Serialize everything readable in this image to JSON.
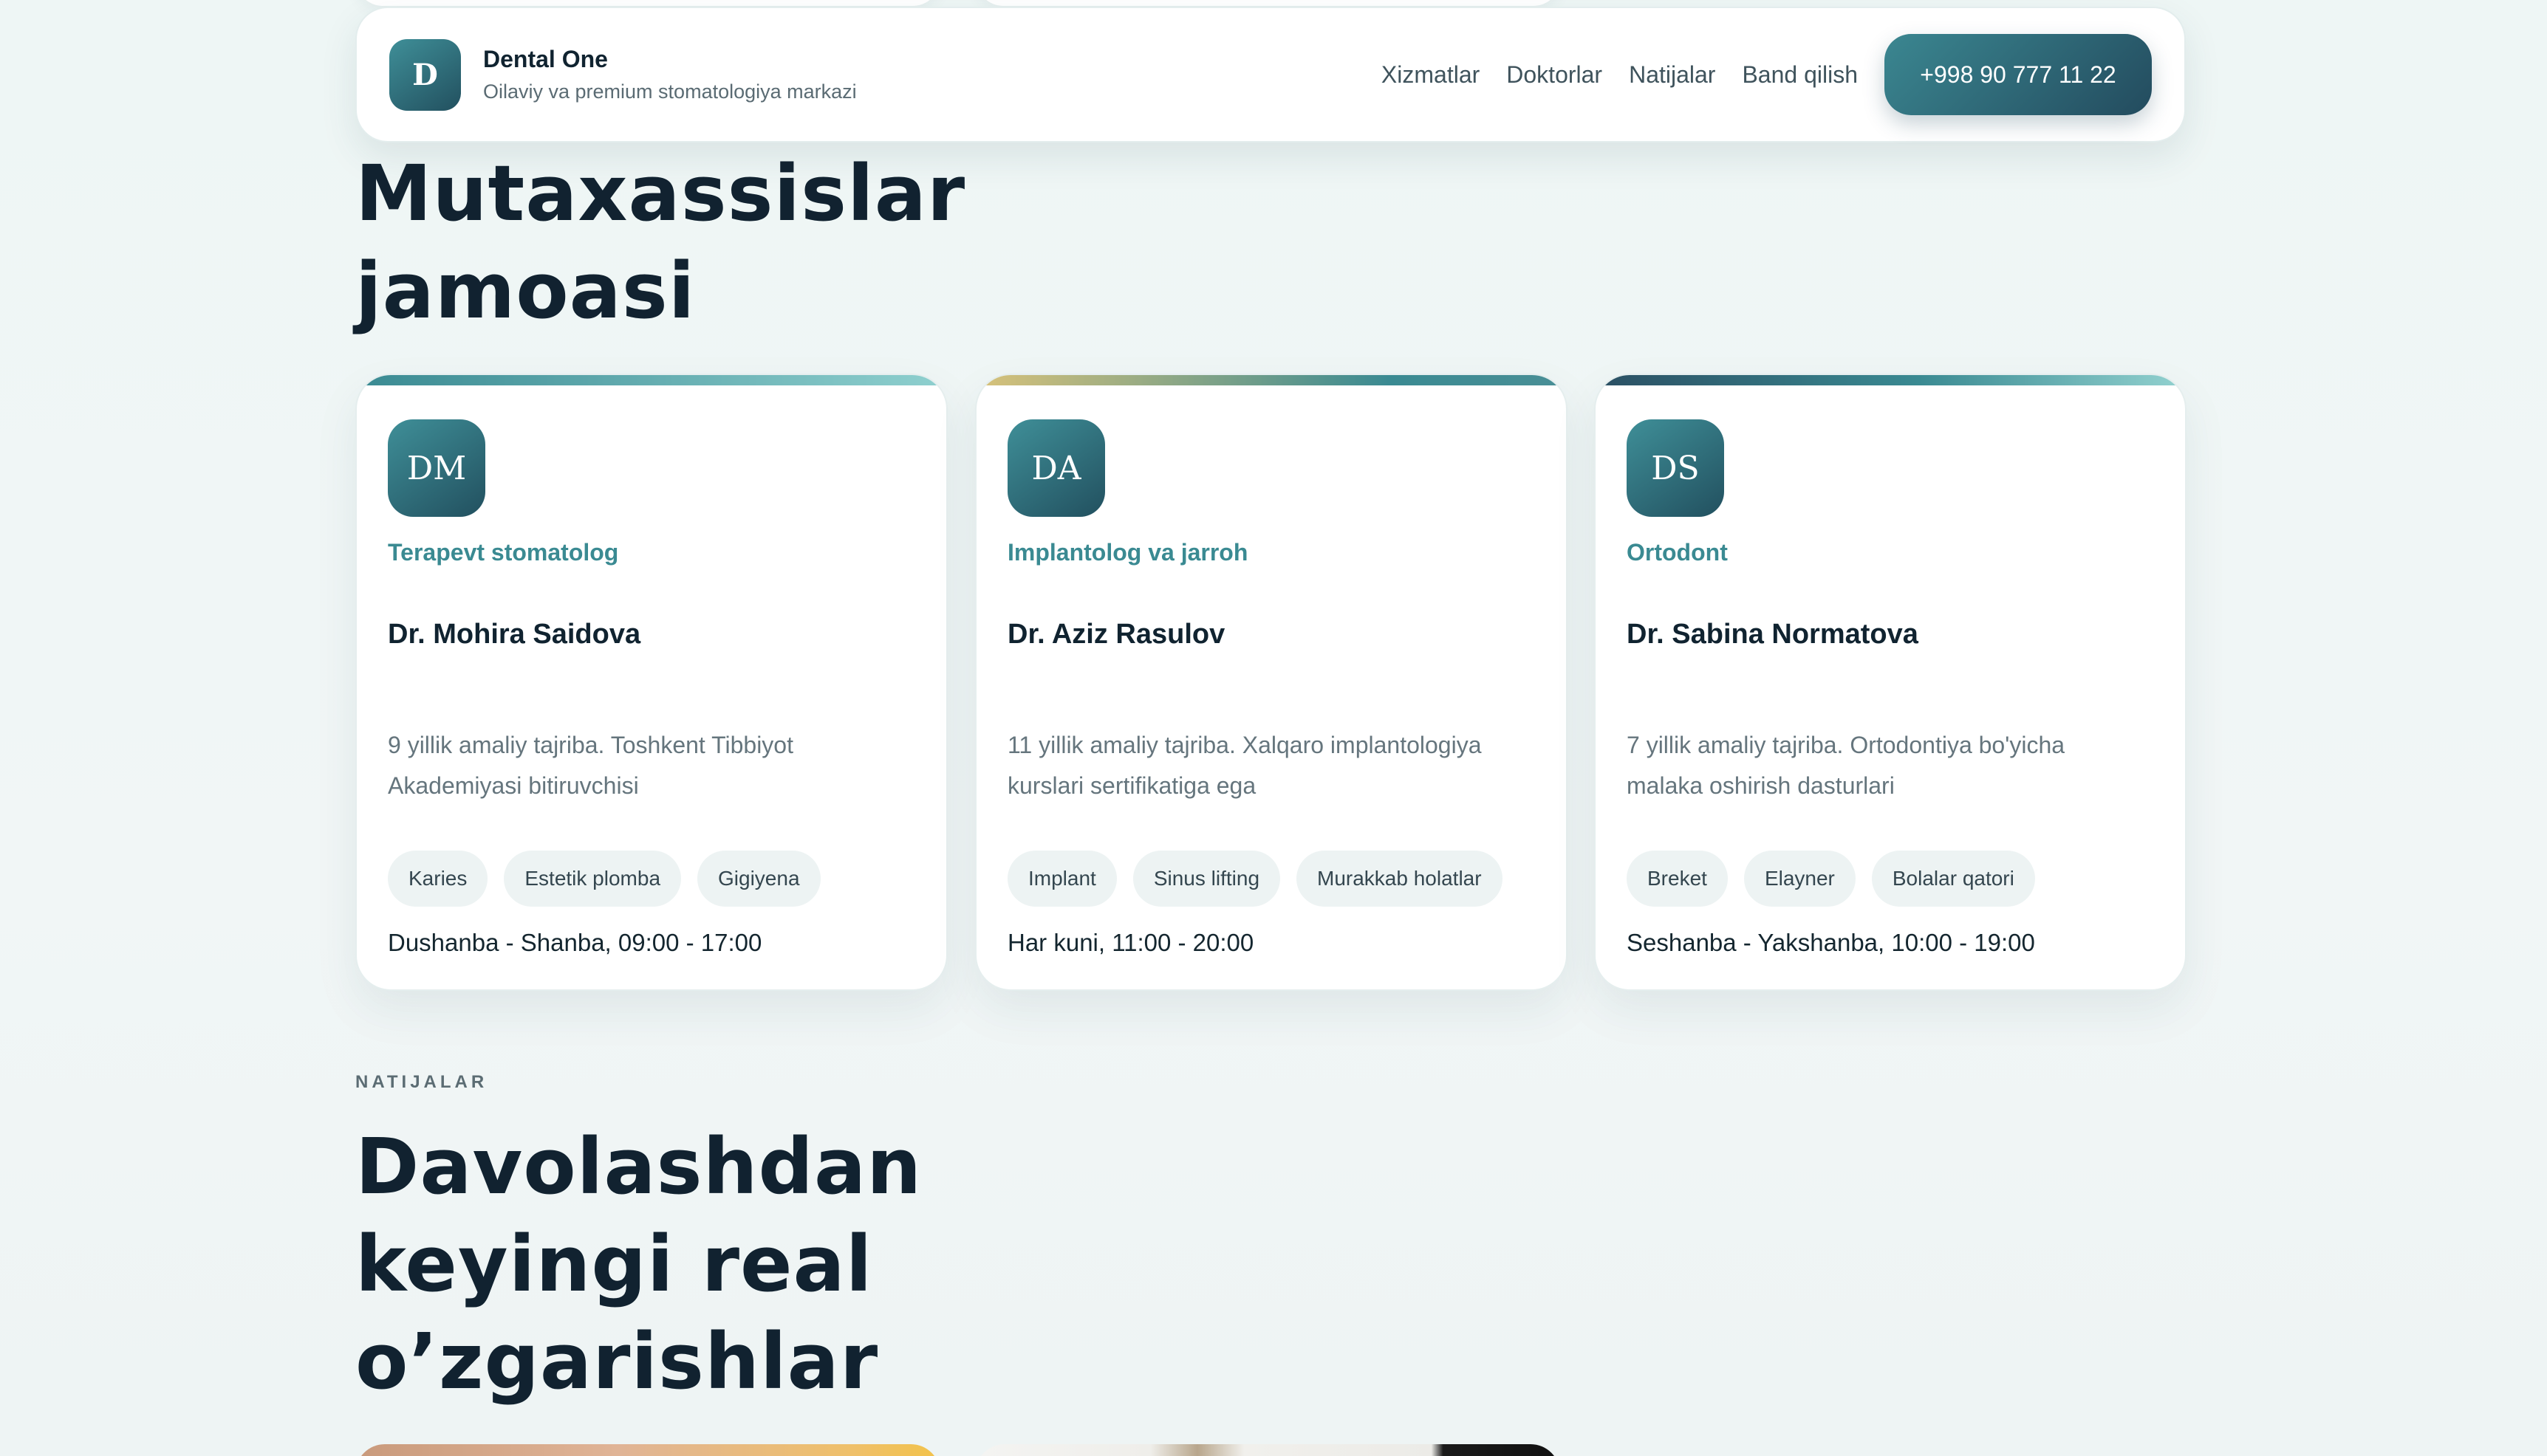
{
  "header": {
    "logo_letter": "D",
    "brand_name": "Dental One",
    "brand_sub": "Oilaviy va premium stomatologiya markazi",
    "nav": [
      "Xizmatlar",
      "Doktorlar",
      "Natijalar",
      "Band qilish"
    ],
    "cta": "+998 90 777 11 22"
  },
  "team": {
    "title_line1": "Mutaxassislar",
    "title_line2": "jamoasi",
    "doctors": [
      {
        "initials": "DM",
        "role": "Terapevt stomatolog",
        "name": "Dr. Mohira Saidova",
        "desc_line1": "9 yillik amaliy tajriba. Toshkent Tibbiyot",
        "desc_line2": "Akademiyasi bitiruvchisi",
        "tags": [
          "Karies",
          "Estetik plomba",
          "Gigiyena"
        ],
        "hours": "Dushanba - Shanba, 09:00 - 17:00"
      },
      {
        "initials": "DA",
        "role": "Implantolog va jarroh",
        "name": "Dr. Aziz Rasulov",
        "desc_line1": "11 yillik amaliy tajriba. Xalqaro implantologiya",
        "desc_line2": "kurslari sertifikatiga ega",
        "tags": [
          "Implant",
          "Sinus lifting",
          "Murakkab holatlar"
        ],
        "hours": "Har kuni, 11:00 - 20:00"
      },
      {
        "initials": "DS",
        "role": "Ortodont",
        "name": "Dr. Sabina Normatova",
        "desc_line1": "7 yillik amaliy tajriba. Ortodontiya bo'yicha",
        "desc_line2": "malaka oshirish dasturlari",
        "tags": [
          "Breket",
          "Elayner",
          "Bolalar qatori"
        ],
        "hours": "Seshanba - Yakshanba, 10:00 - 19:00"
      }
    ]
  },
  "results": {
    "eyebrow": "NATIJALAR",
    "title_line1": "Davolashdan",
    "title_line2": "keyingi real",
    "title_line3": "o’zgarishlar"
  },
  "colors": {
    "accent": "#3a8a92",
    "accent_dark": "#22505f",
    "background": "#eef5f4"
  }
}
